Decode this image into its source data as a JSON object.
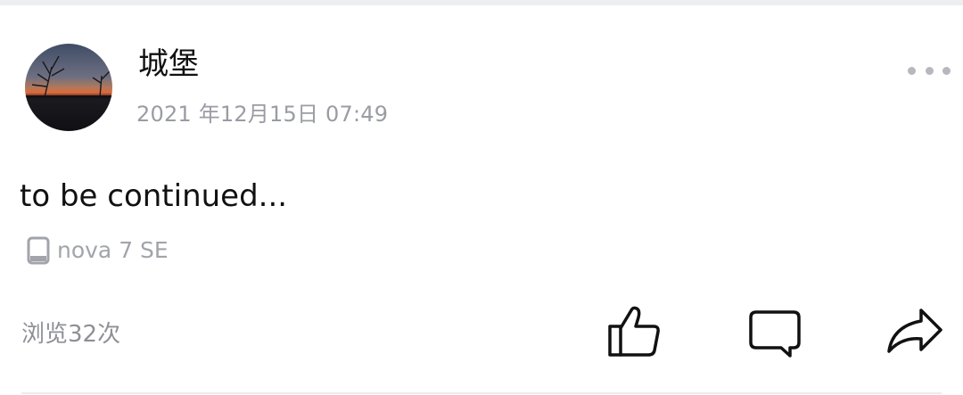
{
  "post": {
    "author": {
      "name": "城堡",
      "avatar": "sunset-silhouette-avatar"
    },
    "timestamp": "2021 年12月15日 07:49",
    "body_text": "to be continued...",
    "device": {
      "icon": "phone-icon",
      "name": "nova 7 SE"
    },
    "view_count_text": "浏览32次"
  },
  "menu": {
    "icon": "more-horizontal-icon"
  },
  "actions": [
    {
      "icon": "thumbs-up-icon"
    },
    {
      "icon": "comment-icon"
    },
    {
      "icon": "share-icon"
    }
  ],
  "colors": {
    "text_primary": "#111111",
    "text_secondary": "#9a9ca3",
    "icon_muted": "#b6b8be",
    "background": "#ffffff"
  }
}
